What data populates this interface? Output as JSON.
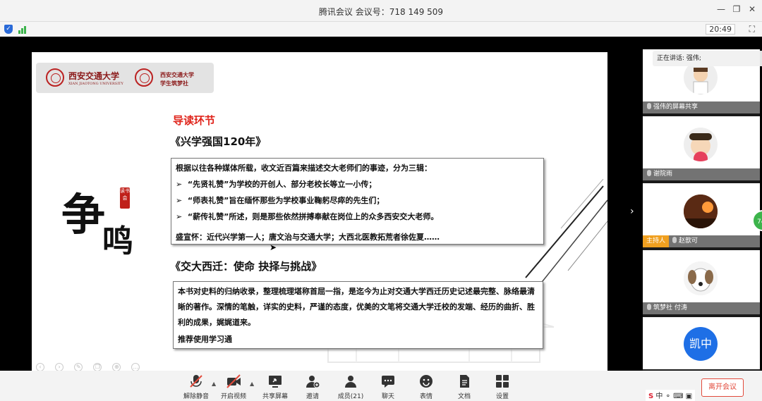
{
  "window": {
    "title": "腾讯会议  会议号：718 149 509",
    "clock": "20:49"
  },
  "slide": {
    "logo_left": "西安交通大学",
    "logo_left_sub": "XIAN JIAOTONG UNIVERSITY",
    "logo_right_line1": "西安交通大学",
    "logo_right_line2": "学生筑梦社",
    "section_title": "导读环节",
    "book1": {
      "title": "《兴学强国120年》",
      "intro": "根据以往各种媒体所载，收文近百篇来描述交大老师们的事迹，分为三辑：",
      "bullets": [
        "“先贤礼赞”为学校的开创人、部分老校长等立一小传；",
        "“师表礼赞”旨在缅怀那些为学校事业鞠躬尽瘁的先生们；",
        "“薪传礼赞”所述，则是那些依然拼搏奉献在岗位上的众多西安交大老师。"
      ],
      "bullet_marker": "➢",
      "footer": "盛宣怀：近代兴学第一人；唐文治与交通大学；大西北医教拓荒者徐佐夏……"
    },
    "book2": {
      "title": "《交大西迁：使命 抉择与挑战》",
      "body": "本书对史料的归纳收录，整理梳理堪称首屈一指，是迄今为止对交通大学西迁历史记述最完整、脉络最清晰的著作。深情的笔触，详实的史料，严谨的态度，优美的文笔将交通大学迁校的发端、经历的曲折、胜利的成果，娓娓道来。",
      "footer": "推荐使用学习通"
    },
    "calligraphy": {
      "char1": "争",
      "char2": "鸣",
      "tag": "读书会"
    }
  },
  "panel": {
    "speaking_label": "正在讲话: 强伟;",
    "participants": [
      {
        "name": "强伟的屏幕共享",
        "host": false
      },
      {
        "name": "谢院雨",
        "host": false
      },
      {
        "name": "赵歆可",
        "host": true
      },
      {
        "name": "筑梦社 付涛",
        "host": false
      }
    ],
    "host_label": "主持人",
    "initials_tile": {
      "initials": "凯中"
    },
    "badge_count": "74"
  },
  "toolbar": {
    "items": [
      {
        "label": "解除静音",
        "icon": "mic-muted-icon"
      },
      {
        "label": "开启视频",
        "icon": "camera-off-icon"
      },
      {
        "label": "共享屏幕",
        "icon": "share-screen-icon"
      },
      {
        "label": "邀请",
        "icon": "invite-icon"
      },
      {
        "label": "成员(21)",
        "icon": "members-icon"
      },
      {
        "label": "聊天",
        "icon": "chat-icon"
      },
      {
        "label": "表情",
        "icon": "emoji-icon"
      },
      {
        "label": "文档",
        "icon": "document-icon"
      },
      {
        "label": "设置",
        "icon": "settings-icon"
      }
    ],
    "leave_label": "离开会议"
  },
  "tray": {
    "text": "中"
  }
}
